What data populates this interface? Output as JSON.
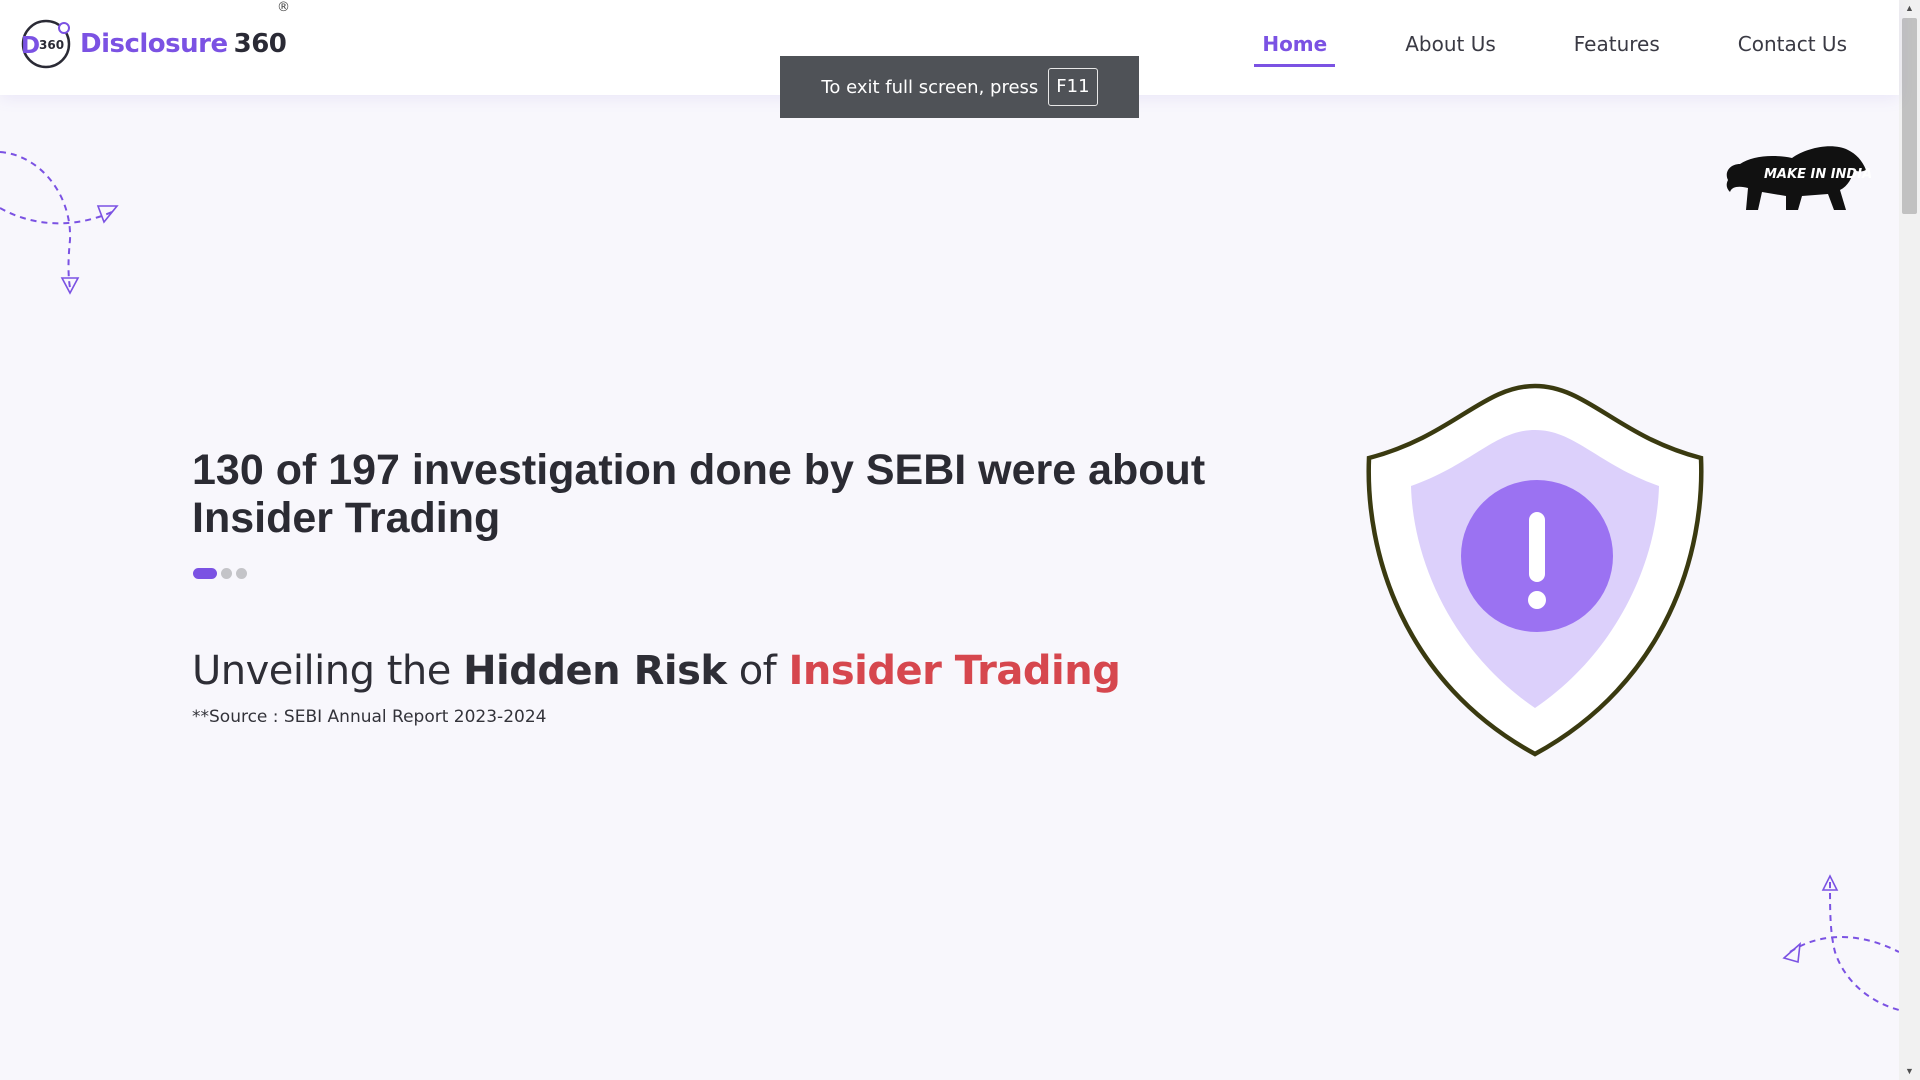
{
  "brand": {
    "mark_text": "360",
    "mark_letter": "D",
    "name": "Disclosure",
    "name_number": "360",
    "registered": "®",
    "primary_color": "#7b52e3"
  },
  "nav": {
    "items": [
      {
        "label": "Home",
        "active": true
      },
      {
        "label": "About Us",
        "active": false
      },
      {
        "label": "Features",
        "active": false
      },
      {
        "label": "Contact Us",
        "active": false
      }
    ]
  },
  "fullscreen_toast": {
    "text": "To exit full screen, press",
    "key": "F11"
  },
  "hero": {
    "headline": "130 of 197 investigation done by SEBI were about Insider Trading",
    "slides": {
      "count": 3,
      "active_index": 0
    },
    "subline": {
      "part1": "Unveiling the ",
      "part2": "Hidden Risk",
      "part3": " of ",
      "part4": "Insider Trading"
    },
    "source": "**Source : SEBI Annual Report 2023-2024",
    "accent_red": "#d6474e"
  },
  "make_in_india": {
    "text": "MAKE IN INDIA"
  },
  "icons": {
    "shield": "shield-alert-icon",
    "arrows": "paper-plane-arrow-icon"
  }
}
